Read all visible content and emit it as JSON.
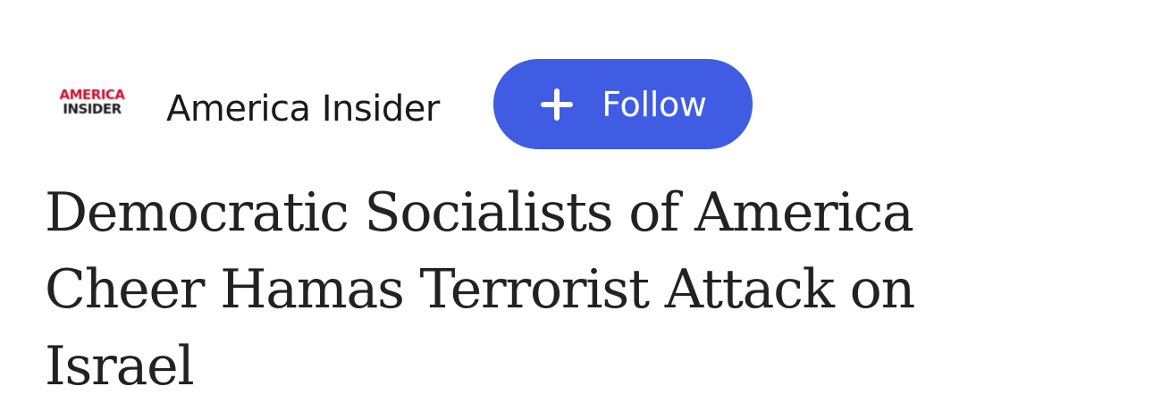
{
  "publisher": {
    "logo_line1": "AMERICA",
    "logo_line2": "INSIDER",
    "name": "America Insider"
  },
  "follow_button": {
    "label": "Follow",
    "icon": "plus-icon",
    "color": "#3f5ce3"
  },
  "article": {
    "headline_lines": [
      "Democratic Socialists of America",
      "Cheer Hamas Terrorist Attack on",
      "Israel"
    ]
  }
}
